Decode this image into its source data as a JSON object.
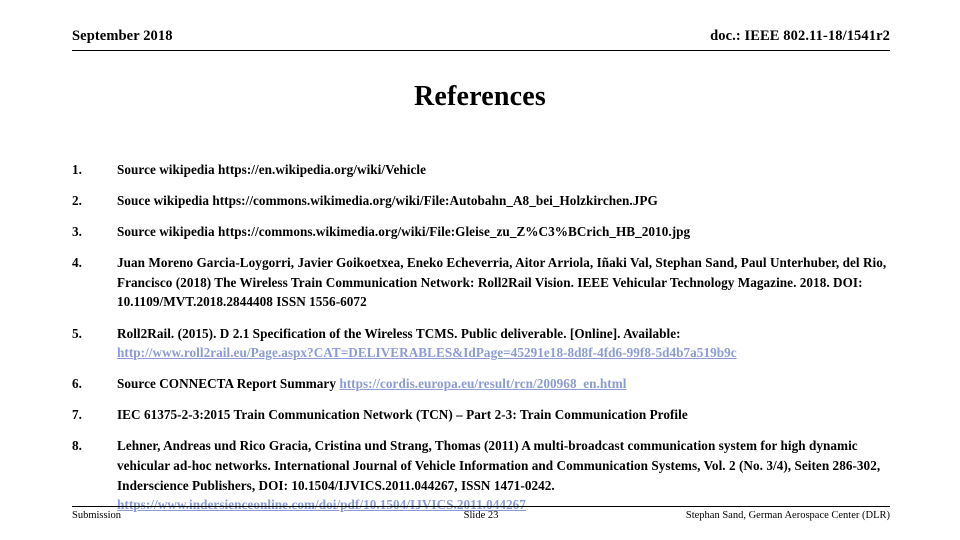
{
  "header": {
    "left": "September 2018",
    "right": "doc.: IEEE 802.11-18/1541r2"
  },
  "title": "References",
  "link_color": "#8C9BD6",
  "references": [
    {
      "number": "1.",
      "text": "Source wikipedia https://en.wikipedia.org/wiki/Vehicle",
      "link": "",
      "link_after": ""
    },
    {
      "number": "2.",
      "text": "Souce wikipedia https://commons.wikimedia.org/wiki/File:Autobahn_A8_bei_Holzkirchen.JPG",
      "link": "",
      "link_after": ""
    },
    {
      "number": "3.",
      "text": "Source wikipedia https://commons.wikimedia.org/wiki/File:Gleise_zu_Z%C3%BCrich_HB_2010.jpg",
      "link": "",
      "link_after": ""
    },
    {
      "number": "4.",
      "text": "Juan Moreno Garcia-Loygorri, Javier Goikoetxea, Eneko Echeverria, Aitor Arriola, Iñaki Val, Stephan Sand, Paul Unterhuber, del Rio, Francisco (2018) The Wireless Train Communication Network: Roll2Rail Vision. IEEE Vehicular Technology Magazine. 2018. DOI: 10.1109/MVT.2018.2844408 ISSN 1556-6072",
      "link": "",
      "link_after": ""
    },
    {
      "number": "5.",
      "text": "Roll2Rail. (2015). D 2.1 Specification of the Wireless TCMS. Public deliverable. [Online]. Available:",
      "link": "http://www.roll2rail.eu/Page.aspx?CAT=DELIVERABLES&IdPage=45291e18-8d8f-4fd6-99f8-5d4b7a519b9c",
      "link_style": "block"
    },
    {
      "number": "6.",
      "text": "Source CONNECTA Report Summary ",
      "link": "https://cordis.europa.eu/result/rcn/200968_en.html",
      "link_style": "inline"
    },
    {
      "number": "7.",
      "text": "IEC 61375-2-3:2015 Train Communication Network (TCN) – Part 2-3: Train Communication Profile",
      "link": "",
      "link_after": ""
    },
    {
      "number": "8.",
      "text": "Lehner, Andreas und Rico Gracia, Cristina und Strang, Thomas (2011) A multi-broadcast communication system for high dynamic vehicular ad-hoc networks. International Journal of Vehicle Information and Communication Systems, Vol. 2 (No. 3/4), Seiten 286-302, Inderscience Publishers, DOI: 10.1504/IJVICS.2011.044267, ISSN 1471-0242.",
      "link": "https://www.indersienceonline.com/doi/pdf/10.1504/IJVICS.2011.044267",
      "link_style": "block"
    }
  ],
  "footer": {
    "left": "Submission",
    "center": "Slide 23",
    "right": "Stephan Sand, German Aerospace Center (DLR)"
  }
}
